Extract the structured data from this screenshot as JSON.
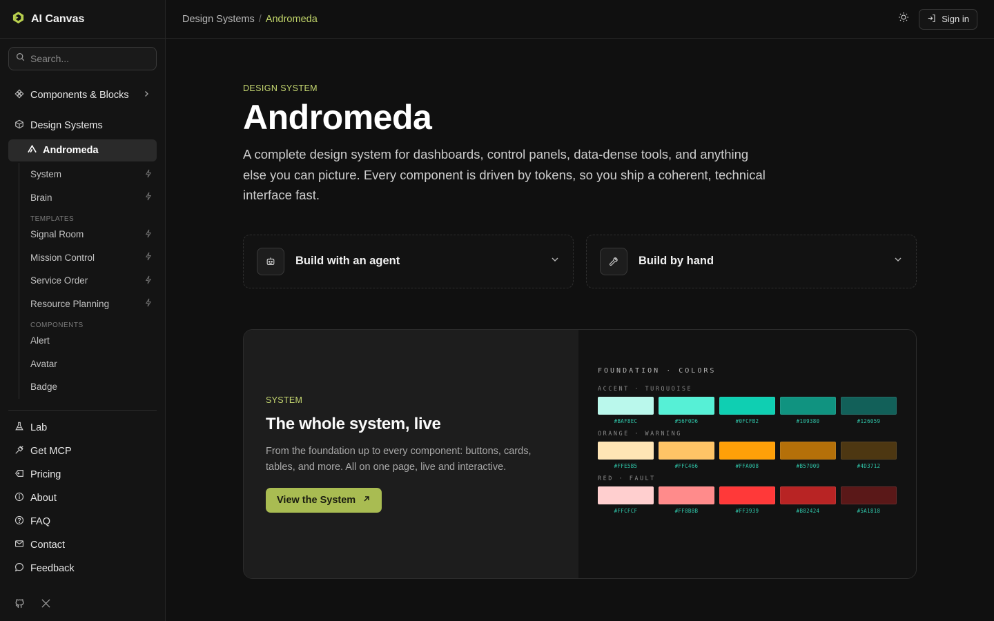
{
  "app": {
    "name": "AI Canvas"
  },
  "search": {
    "placeholder": "Search..."
  },
  "sidebar": {
    "components_blocks": "Components & Blocks",
    "design_systems": "Design Systems",
    "active": "Andromeda",
    "system_items": [
      {
        "label": "System"
      },
      {
        "label": "Brain"
      }
    ],
    "templates_heading": "TEMPLATES",
    "templates": [
      {
        "label": "Signal Room"
      },
      {
        "label": "Mission Control"
      },
      {
        "label": "Service Order"
      },
      {
        "label": "Resource Planning"
      }
    ],
    "components_heading": "COMPONENTS",
    "components": [
      {
        "label": "Alert"
      },
      {
        "label": "Avatar"
      },
      {
        "label": "Badge"
      }
    ],
    "bottom": [
      {
        "label": "Lab",
        "icon": "flask-icon"
      },
      {
        "label": "Get MCP",
        "icon": "plug-icon"
      },
      {
        "label": "Pricing",
        "icon": "tag-icon"
      },
      {
        "label": "About",
        "icon": "info-icon"
      },
      {
        "label": "FAQ",
        "icon": "help-icon"
      },
      {
        "label": "Contact",
        "icon": "mail-icon"
      },
      {
        "label": "Feedback",
        "icon": "message-icon"
      }
    ]
  },
  "breadcrumb": {
    "parent": "Design Systems",
    "separator": "/",
    "current": "Andromeda"
  },
  "header": {
    "sign_in": "Sign in"
  },
  "hero": {
    "eyebrow": "DESIGN SYSTEM",
    "title": "Andromeda",
    "description": "A complete design system for dashboards, control panels, data-dense tools, and anything else you can picture. Every component is driven by tokens, so you ship a coherent, technical interface fast."
  },
  "build": {
    "agent": "Build with an agent",
    "hand": "Build by hand"
  },
  "system_card": {
    "eyebrow": "SYSTEM",
    "title": "The whole system, live",
    "description": "From the foundation up to every component: buttons, cards, tables, and more. All on one page, live and interactive.",
    "button": "View the System"
  },
  "palette": {
    "heading": "FOUNDATION · COLORS",
    "groups": [
      {
        "label": "ACCENT · TURQUOISE",
        "colors": [
          "#BAF8EC",
          "#56F0D6",
          "#0FCFB2",
          "#109380",
          "#126059"
        ]
      },
      {
        "label": "ORANGE · WARNING",
        "colors": [
          "#FFE5B5",
          "#FFC466",
          "#FFA008",
          "#B57009",
          "#4D3712"
        ]
      },
      {
        "label": "RED · FAULT",
        "colors": [
          "#FFCFCF",
          "#FF8B8B",
          "#FF3939",
          "#B82424",
          "#5A1818"
        ]
      }
    ]
  },
  "colors": {
    "accent": "#C8DA72",
    "button": "#A9BC52"
  }
}
